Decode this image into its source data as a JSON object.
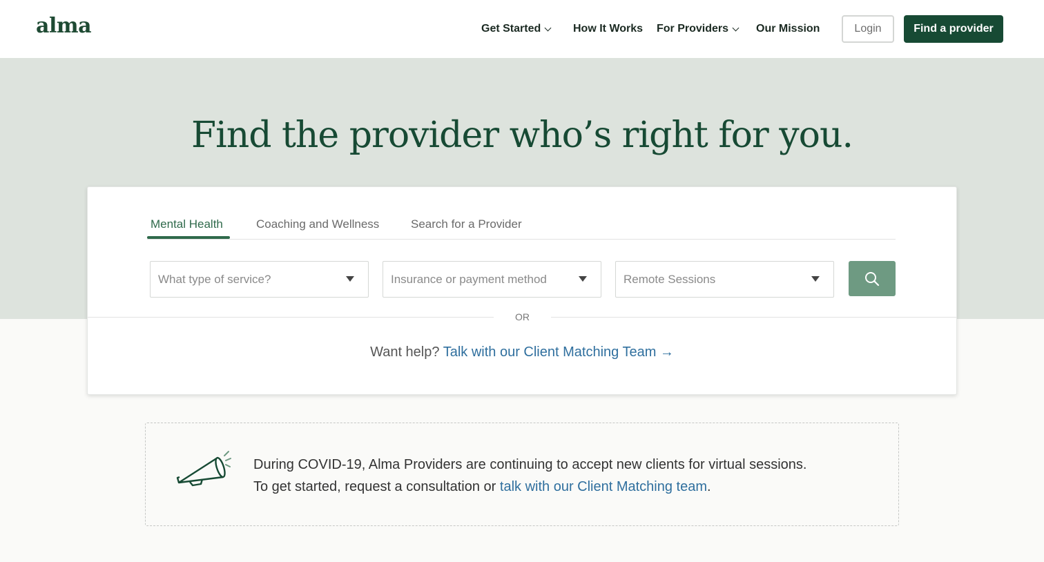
{
  "header": {
    "logo": "alma",
    "nav": [
      {
        "label": "Get Started",
        "has_dropdown": true
      },
      {
        "label": "How It Works",
        "has_dropdown": false
      },
      {
        "label": "For Providers",
        "has_dropdown": true
      },
      {
        "label": "Our Mission",
        "has_dropdown": false
      }
    ],
    "login_label": "Login",
    "find_provider_label": "Find a provider"
  },
  "hero": {
    "title": "Find the provider who’s right for you."
  },
  "search_card": {
    "tabs": [
      {
        "label": "Mental Health",
        "active": true
      },
      {
        "label": "Coaching and Wellness",
        "active": false
      },
      {
        "label": "Search for a Provider",
        "active": false
      }
    ],
    "selects": [
      {
        "placeholder": "What type of service?"
      },
      {
        "placeholder": "Insurance or payment method"
      },
      {
        "placeholder": "Remote Sessions"
      }
    ],
    "search_icon": "search-icon",
    "or_label": "OR",
    "help_prefix": "Want help?",
    "help_link": "Talk with our Client Matching Team →"
  },
  "notice": {
    "icon": "megaphone-icon",
    "line1": "During COVID-19, Alma Providers are continuing to accept new clients for virtual sessions.",
    "line2_prefix": "To get started, request a consultation or",
    "line2_link": "talk with our Client Matching team",
    "line2_suffix": "."
  },
  "colors": {
    "brand": "#174a34",
    "hero_bg": "#dde3dd",
    "accent_green": "#2f6a4b",
    "search_button": "#6e9a82",
    "link_blue": "#2f6f9e"
  }
}
